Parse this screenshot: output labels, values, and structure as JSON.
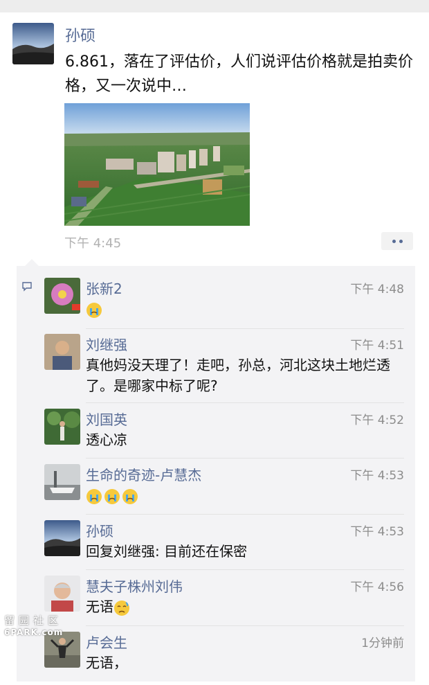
{
  "post": {
    "author": "孙硕",
    "text": "6.861，落在了评估价，人们说评估价格就是拍卖价格，又一次说中…",
    "time": "下午 4:45"
  },
  "comments": [
    {
      "name": "张新2",
      "time": "下午 4:48",
      "text": "",
      "emoji": [
        "crying-face"
      ]
    },
    {
      "name": "刘继强",
      "time": "下午 4:51",
      "text": "真他妈没天理了！走吧，孙总，河北这块土地烂透了。是哪家中标了呢?",
      "emoji": []
    },
    {
      "name": "刘国英",
      "time": "下午 4:52",
      "text": "透心凉",
      "emoji": []
    },
    {
      "name": "生命的奇迹-卢慧杰",
      "time": "下午 4:53",
      "text": "",
      "emoji": [
        "crying-face",
        "crying-face",
        "crying-face"
      ]
    },
    {
      "name": "孙硕",
      "time": "下午 4:53",
      "text": "回复刘继强: 目前还在保密",
      "emoji": []
    },
    {
      "name": "慧夫子株州刘伟",
      "time": "下午 4:56",
      "text": "无语",
      "emoji": [
        "sad-face"
      ]
    },
    {
      "name": "卢会生",
      "time": "1分钟前",
      "text": "无语，",
      "emoji": []
    }
  ],
  "watermark": {
    "cn": "留园社区",
    "en": "6PARK.com"
  },
  "colors": {
    "name_link": "#576b95",
    "comment_bg": "#f3f3f5"
  }
}
